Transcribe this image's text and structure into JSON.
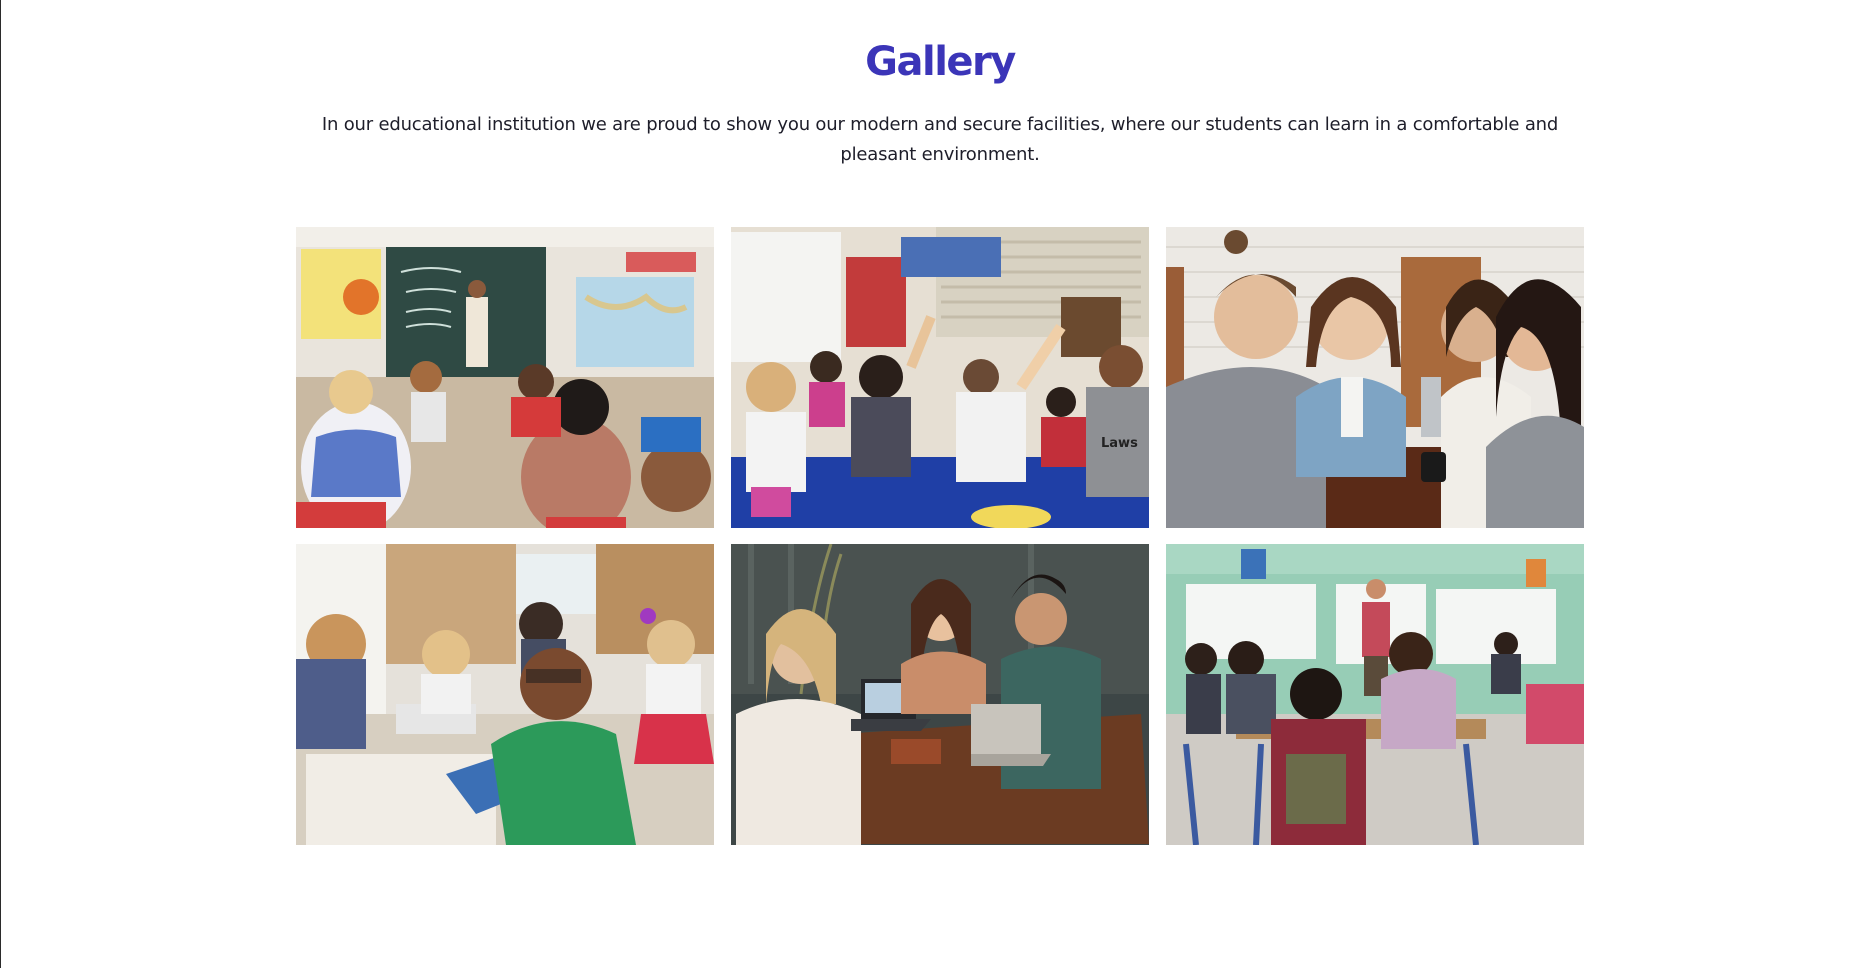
{
  "gallery": {
    "title": "Gallery",
    "description": "In our educational institution we are proud to show you our modern and secure facilities, where our students can learn in a comfortable and pleasant environment."
  },
  "colors": {
    "title": "#3b35b8",
    "text": "#1e1e2a",
    "background": "#ffffff"
  },
  "photos": [
    {
      "scene": "classroom-teacher-at-chalkboard"
    },
    {
      "scene": "children-sitting-on-carpet-raising-hands"
    },
    {
      "scene": "young-adults-studying-at-table"
    },
    {
      "scene": "children-drawing-at-table"
    },
    {
      "scene": "students-laughing-with-laptops-in-cafe"
    },
    {
      "scene": "classroom-teacher-at-whiteboard"
    }
  ]
}
